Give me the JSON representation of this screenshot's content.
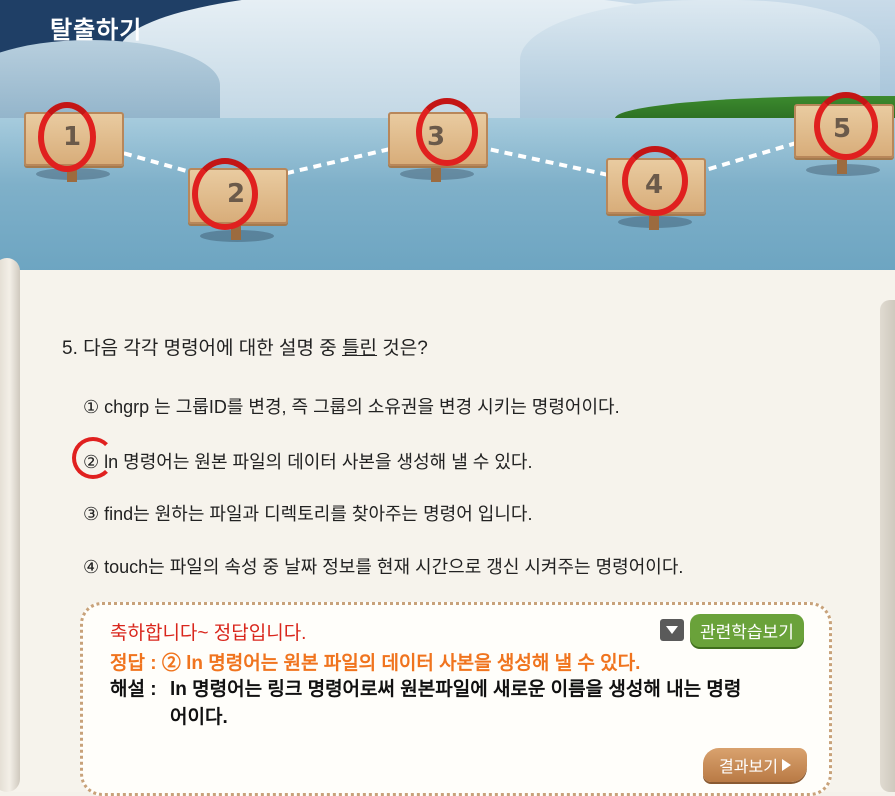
{
  "header": {
    "title": "탈출하기"
  },
  "stages": [
    {
      "number": "1"
    },
    {
      "number": "2"
    },
    {
      "number": "3"
    },
    {
      "number": "4"
    },
    {
      "number": "5"
    }
  ],
  "question": {
    "prefix": "5. 다음 각각 명령어에 대한 설명 중 ",
    "emphasis": "틀린",
    "suffix": " 것은?"
  },
  "options": [
    {
      "label": "① chgrp 는 그룹ID를 변경, 즉 그룹의 소유권을 변경 시키는 명령어이다."
    },
    {
      "label": "② ln 명령어는 원본 파일의 데이터 사본을 생성해 낼 수 있다."
    },
    {
      "label": "③ find는 원하는 파일과 디렉토리를 찾아주는  명령어 입니다."
    },
    {
      "label": "④ touch는 파일의 속성 중 날짜 정보를 현재 시간으로 갱신 시켜주는 명령어이다."
    }
  ],
  "answer": {
    "congrats": "축하합니다~ 정답입니다.",
    "correct": "정답 : ② ln 명령어는 원본 파일의 데이터 사본을 생성해 낼 수 있다.",
    "explain_label": "해설 :",
    "explain_text": "ln 명령어는 링크 명령어로써 원본파일에 새로운 이름을 생성해 내는 명령어이다.",
    "related_label": "관련학습보기",
    "result_label": "결과보기"
  },
  "colors": {
    "ring": "#e0201f",
    "congrats": "#d9261c",
    "correct": "#f0741e",
    "related_button": "#6aa23a"
  }
}
